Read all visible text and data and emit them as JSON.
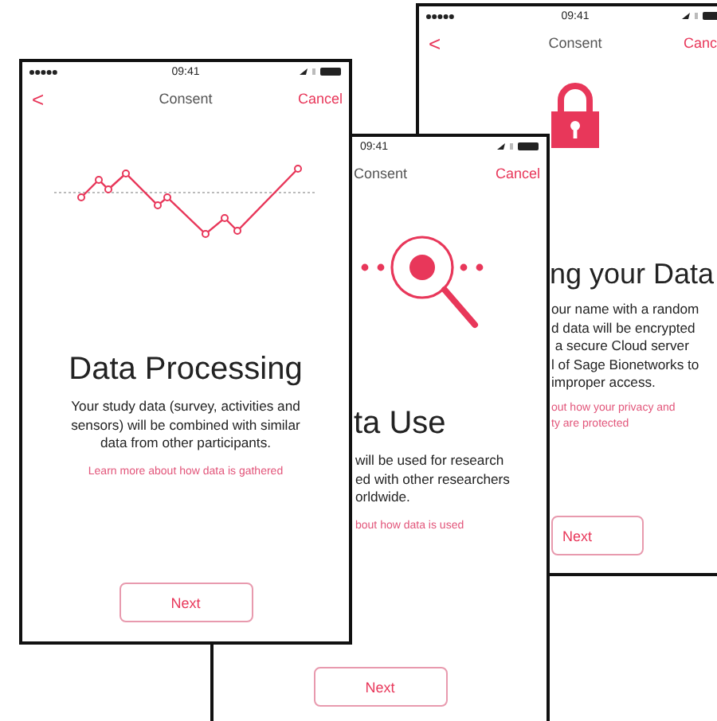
{
  "phones": [
    {
      "kind": "lock",
      "time": "09:41",
      "back": "<",
      "nav_title": "Consent",
      "cancel": "Canc",
      "title": "ng your Data",
      "body": "our name with a random\nd data will be encrypted\n a secure Cloud server\nl of Sage Bionetworks to\nimproper access.",
      "link": "out how your privacy and\nty are protected",
      "button": "Next"
    },
    {
      "kind": "magnifier",
      "time": "09:41",
      "nav_title": "Consent",
      "cancel": "Cancel",
      "title": "ta Use",
      "body": "will be used for research\ned with other researchers\norldwide.",
      "link": "bout how data is used",
      "button": "Next"
    },
    {
      "kind": "chart",
      "time": "09:41",
      "back": "<",
      "nav_title": "Consent",
      "cancel": "Cancel",
      "title": "Data Processing",
      "body": "Your study data (survey, activities and sensors) will be combined with similar data from other participants.",
      "link": "Learn more about how data is gathered",
      "button": "Next"
    }
  ]
}
